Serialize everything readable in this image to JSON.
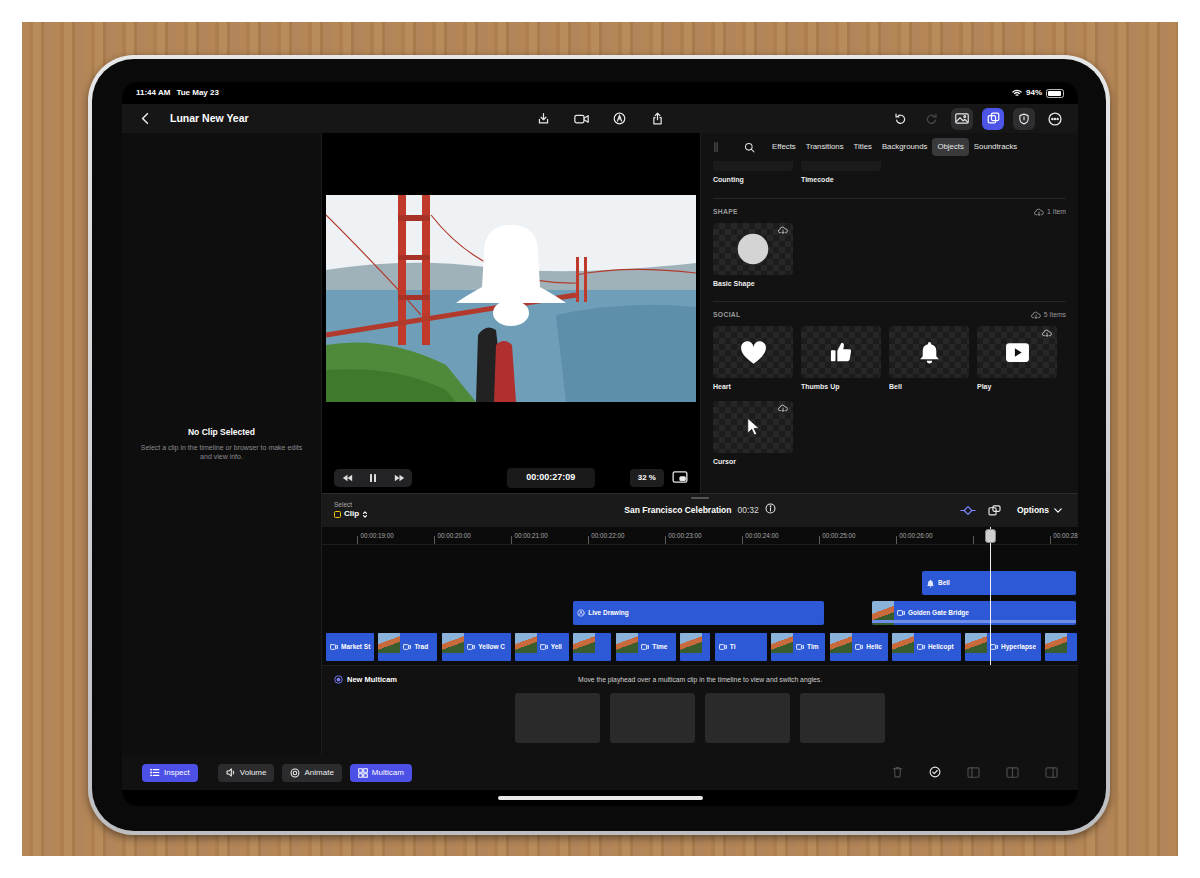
{
  "status_bar": {
    "time": "11:44 AM",
    "date": "Tue May 23",
    "battery": "94%",
    "battery_level": 0.94
  },
  "toolbar": {
    "project_title": "Lunar New Year",
    "redo_disabled": true,
    "photos_selected": false,
    "browser_selected": true
  },
  "inspector": {
    "title": "No Clip Selected",
    "hint": "Select a clip in the timeline or browser to make edits and view info."
  },
  "viewer": {
    "playing": true,
    "timecode": "00:00:27:09",
    "zoom": "32 %"
  },
  "browser": {
    "tabs": [
      {
        "label": "Effects",
        "selected": false
      },
      {
        "label": "Transitions",
        "selected": false
      },
      {
        "label": "Titles",
        "selected": false
      },
      {
        "label": "Backgrounds",
        "selected": false
      },
      {
        "label": "Objects",
        "selected": true
      },
      {
        "label": "Soundtracks",
        "selected": false
      }
    ],
    "partial_items": [
      "Counting",
      "Timecode"
    ],
    "sections": [
      {
        "title": "SHAPE",
        "count": "1 Item",
        "items": [
          {
            "label": "Basic Shape",
            "kind": "circle",
            "cloud": true
          }
        ]
      },
      {
        "title": "SOCIAL",
        "count": "5 Items",
        "items": [
          {
            "label": "Heart",
            "kind": "heart",
            "cloud": false
          },
          {
            "label": "Thumbs Up",
            "kind": "thumbs",
            "cloud": false
          },
          {
            "label": "Bell",
            "kind": "bell",
            "cloud": false
          },
          {
            "label": "Play",
            "kind": "play",
            "cloud": true
          },
          {
            "label": "Cursor",
            "kind": "cursor",
            "cloud": true
          }
        ]
      }
    ]
  },
  "timeline": {
    "select_label": "Select",
    "edit_mode": "Clip",
    "project": "San Francisco Celebration",
    "duration": "00:32",
    "options": "Options",
    "view_start": 18.54,
    "view_end": 28.36,
    "playhead": 27.22,
    "ruler": [
      {
        "label": "00:00:19:00",
        "time": 19
      },
      {
        "label": "00:00:20:00",
        "time": 20
      },
      {
        "label": "00:00:21:00",
        "time": 21
      },
      {
        "label": "00:00:22:00",
        "time": 22
      },
      {
        "label": "00:00:23:00",
        "time": 23
      },
      {
        "label": "00:00:24:00",
        "time": 24
      },
      {
        "label": "00:00:25:00",
        "time": 25
      },
      {
        "label": "00:00:26:00",
        "time": 26
      },
      {
        "label": "00:00:28",
        "time": 28
      }
    ],
    "connected_clips": [
      {
        "label": "Bell",
        "kind": "object",
        "lane": 1,
        "start": 26.32,
        "end": 28.36
      },
      {
        "label": "Live Drawing",
        "kind": "drawing",
        "lane": 2,
        "start": 21.79,
        "end": 25.09
      },
      {
        "label": "Golden Gate Bridge",
        "kind": "video",
        "lane": 2,
        "start": 25.67,
        "end": 28.36
      }
    ],
    "primary_clips": [
      {
        "label": "Market St",
        "start": 18.58,
        "end": 19.23
      },
      {
        "label": "Trad",
        "start": 19.26,
        "end": 20.05
      },
      {
        "label": "Yellow C",
        "start": 20.09,
        "end": 21.01
      },
      {
        "label": "Yell",
        "start": 21.03,
        "end": 21.76
      },
      {
        "start": 21.79,
        "end": 22.31
      },
      {
        "label": "Time",
        "start": 22.35,
        "end": 23.15
      },
      {
        "start": 23.18,
        "end": 23.59
      },
      {
        "label": "Ti",
        "start": 23.63,
        "end": 24.33
      },
      {
        "label": "Tim",
        "start": 24.36,
        "end": 25.09
      },
      {
        "label": "Helic",
        "start": 25.13,
        "end": 25.9
      },
      {
        "label": "Helicopt",
        "start": 25.93,
        "end": 26.85
      },
      {
        "label": "Hyperlapse",
        "start": 26.88,
        "end": 27.89
      },
      {
        "start": 27.92,
        "end": 28.36
      }
    ]
  },
  "multicam": {
    "title": "New Multicam",
    "hint": "Move the playhead over a multicam clip in the timeline to view and switch angles."
  },
  "bottom_bar": {
    "buttons": [
      {
        "label": "Inspect",
        "kind": "inspect",
        "selected": true
      },
      {
        "label": "Volume",
        "kind": "volume",
        "selected": false
      },
      {
        "label": "Animate",
        "kind": "animate",
        "selected": false
      },
      {
        "label": "Multicam",
        "kind": "multicam",
        "selected": true
      }
    ],
    "edit_tools": [
      {
        "kind": "delete",
        "disabled": true
      },
      {
        "kind": "check",
        "disabled": false
      },
      {
        "kind": "split-left",
        "disabled": true
      },
      {
        "kind": "split-center",
        "disabled": true
      },
      {
        "kind": "split-right",
        "disabled": true
      }
    ]
  }
}
